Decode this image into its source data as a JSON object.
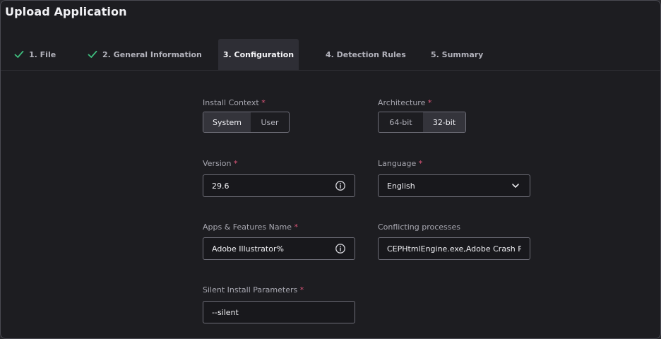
{
  "header": {
    "title": "Upload Application"
  },
  "steps": [
    {
      "label": "1. File",
      "completed": true
    },
    {
      "label": "2. General Information",
      "completed": true
    },
    {
      "label": "3. Configuration",
      "active": true
    },
    {
      "label": "4. Detection Rules"
    },
    {
      "label": "5. Summary"
    }
  ],
  "form": {
    "required_mark": "*",
    "install_context": {
      "label": "Install Context",
      "options": [
        "System",
        "User"
      ],
      "selected": "System"
    },
    "architecture": {
      "label": "Architecture",
      "options": [
        "64-bit",
        "32-bit"
      ],
      "selected": "32-bit"
    },
    "version": {
      "label": "Version",
      "value": "29.6"
    },
    "language": {
      "label": "Language",
      "value": "English"
    },
    "apps_features_name": {
      "label": "Apps & Features Name",
      "value": "Adobe Illustrator%"
    },
    "conflicting_processes": {
      "label": "Conflicting processes",
      "value": "CEPHtmlEngine.exe,Adobe Crash Pr"
    },
    "silent_install_parameters": {
      "label": "Silent Install Parameters",
      "value": "--silent"
    }
  },
  "colors": {
    "success": "#3fbf7f",
    "required": "#e0567a",
    "background": "#1d1d21"
  }
}
